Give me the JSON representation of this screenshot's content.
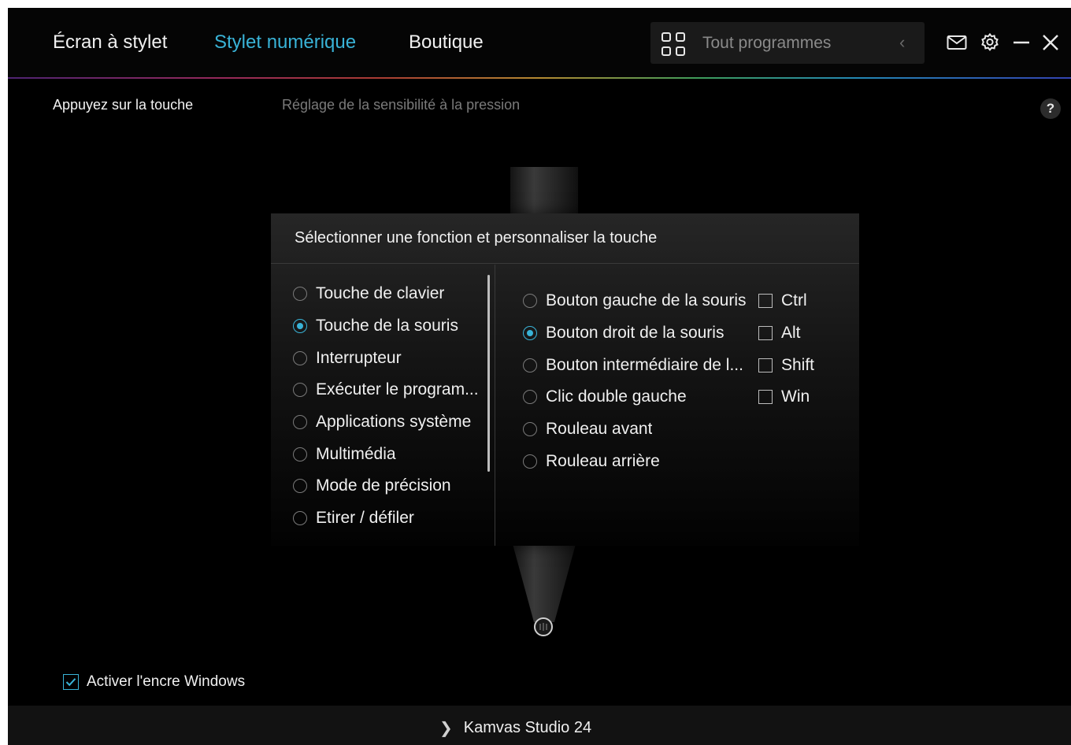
{
  "nav": {
    "tabs": [
      {
        "label": "Écran à stylet",
        "active": false
      },
      {
        "label": "Stylet numérique",
        "active": true
      },
      {
        "label": "Boutique",
        "active": false
      }
    ],
    "program_selector": {
      "label": "Tout programmes",
      "icon": "grid-icon",
      "chevron": "chevron-left-icon"
    },
    "window_controls": [
      "mail-icon",
      "gear-icon",
      "minimize-icon",
      "close-icon"
    ]
  },
  "subnav": {
    "tabs": [
      {
        "label": "Appuyez sur la touche",
        "active": true
      },
      {
        "label": "Réglage de la sensibilité à la pression",
        "active": false
      }
    ],
    "help_label": "?"
  },
  "dialog": {
    "title": "Sélectionner une fonction et personnaliser la touche",
    "function_types": [
      {
        "label": "Touche de clavier",
        "selected": false
      },
      {
        "label": "Touche de la souris",
        "selected": true
      },
      {
        "label": "Interrupteur",
        "selected": false
      },
      {
        "label": "Exécuter le program...",
        "selected": false
      },
      {
        "label": "Applications système",
        "selected": false
      },
      {
        "label": "Multimédia",
        "selected": false
      },
      {
        "label": "Mode de précision",
        "selected": false
      },
      {
        "label": "Etirer / défiler",
        "selected": false
      },
      {
        "label": "",
        "selected": false
      }
    ],
    "mouse_options": [
      {
        "label": "Bouton gauche de la souris",
        "selected": false
      },
      {
        "label": "Bouton droit de la souris",
        "selected": true
      },
      {
        "label": "Bouton intermédiaire de l...",
        "selected": false
      },
      {
        "label": "Clic double gauche",
        "selected": false
      },
      {
        "label": "Rouleau avant",
        "selected": false
      },
      {
        "label": "Rouleau arrière",
        "selected": false
      }
    ],
    "modifiers": [
      {
        "label": "Ctrl",
        "checked": false
      },
      {
        "label": "Alt",
        "checked": false
      },
      {
        "label": "Shift",
        "checked": false
      },
      {
        "label": "Win",
        "checked": false
      }
    ]
  },
  "windows_ink": {
    "label": "Activer l'encre Windows",
    "checked": true
  },
  "device": {
    "name": "Kamvas Studio 24"
  },
  "colors": {
    "accent": "#39b3d7",
    "background": "#000000",
    "dialog": "#1c1c1c"
  }
}
